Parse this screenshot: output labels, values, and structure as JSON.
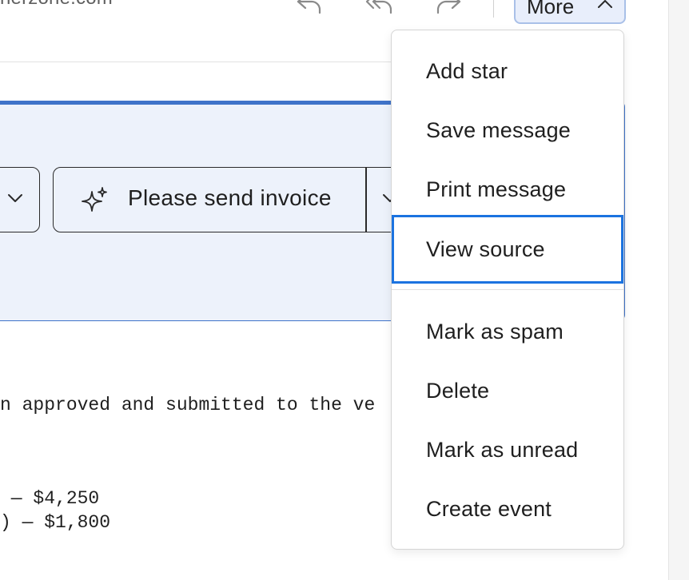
{
  "header": {
    "sender_email": "nerzone.com",
    "toolbar": [
      {
        "icon": "reply-icon"
      },
      {
        "icon": "reply-all-icon"
      },
      {
        "icon": "forward-icon"
      }
    ],
    "more_label": "More"
  },
  "ai_panel": {
    "suggestion": "Please send invoice"
  },
  "body_lines": [
    "n approved and submitted to the ve",
    " — $4,250",
    ") — $1,800"
  ],
  "more_menu": {
    "items": [
      {
        "label": "Add star"
      },
      {
        "label": "Save message"
      },
      {
        "label": "Print message"
      },
      {
        "label": "View source",
        "focused": true
      },
      {
        "label": "Mark as spam"
      },
      {
        "label": "Delete"
      },
      {
        "label": "Mark as unread"
      },
      {
        "label": "Create event"
      }
    ]
  },
  "colors": {
    "accent": "#3f73c9",
    "panel_bg": "#edf2fb",
    "focus_ring": "#1b73e0"
  }
}
